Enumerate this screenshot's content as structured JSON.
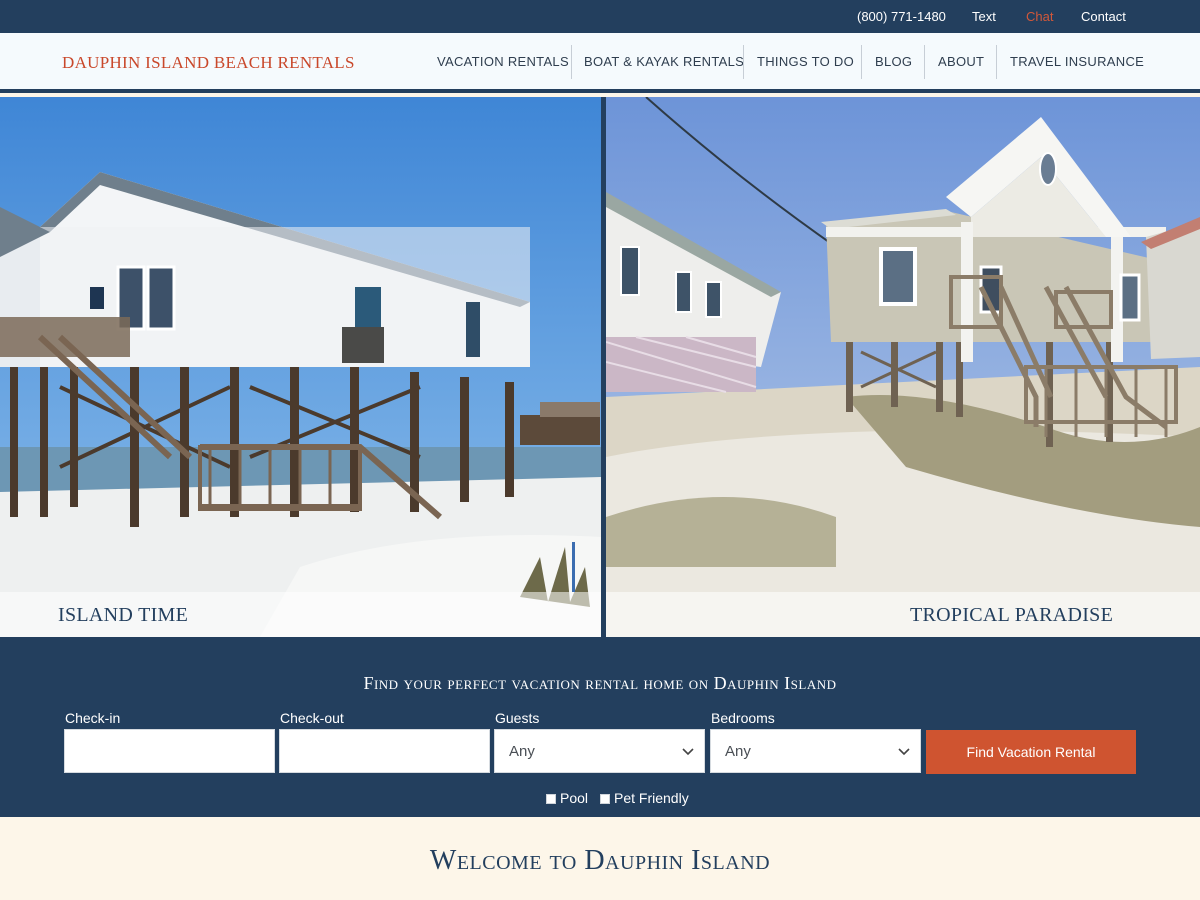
{
  "topbar": {
    "phone": "(800) 771-1480",
    "text_label": "Text",
    "chat_label": "Chat",
    "contact_label": "Contact",
    "chat_color": "#d2583a"
  },
  "header": {
    "brand": "DAUPHIN ISLAND BEACH RENTALS",
    "nav": [
      {
        "label": "VACATION RENTALS"
      },
      {
        "label": "BOAT & KAYAK RENTALS"
      },
      {
        "label": "THINGS TO DO"
      },
      {
        "label": "BLOG"
      },
      {
        "label": "ABOUT"
      },
      {
        "label": "TRAVEL INSURANCE"
      }
    ]
  },
  "hero": {
    "panels": [
      {
        "caption": "ISLAND TIME",
        "image": "white-stilt-beach-house-photo"
      },
      {
        "caption": "TROPICAL PARADISE",
        "image": "beige-cottage-on-dunes-photo"
      }
    ]
  },
  "search": {
    "title": "Find your perfect vacation rental home on Dauphin Island",
    "checkin_label": "Check-in",
    "checkin_value": "",
    "checkout_label": "Check-out",
    "checkout_value": "",
    "guests_label": "Guests",
    "guests_value": "Any",
    "bedrooms_label": "Bedrooms",
    "bedrooms_value": "Any",
    "submit_label": "Find Vacation Rental",
    "pool_label": "Pool",
    "pool_checked": false,
    "pet_label": "Pet Friendly",
    "pet_checked": false
  },
  "welcome": {
    "heading": "Welcome to Dauphin Island"
  },
  "colors": {
    "navy": "#233f5e",
    "accent": "#cf5430",
    "brand": "#c9482b",
    "cream": "#fdf6e9"
  }
}
